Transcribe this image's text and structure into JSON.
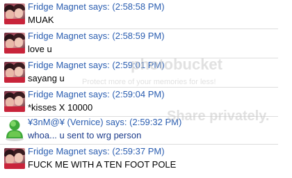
{
  "messages": [
    {
      "sender": "Fridge Magnet says:",
      "time": "(2:58:58 PM)",
      "text": "MUAK",
      "avatar": "photo-avatar"
    },
    {
      "sender": "Fridge Magnet says:",
      "time": "(2:58:59 PM)",
      "text": "love u",
      "avatar": "photo-avatar"
    },
    {
      "sender": "Fridge Magnet says:",
      "time": "(2:59:01 PM)",
      "text": "sayang u",
      "avatar": "photo-avatar"
    },
    {
      "sender": "Fridge Magnet says:",
      "time": "(2:59:04 PM)",
      "text": "*kisses X 10000",
      "avatar": "photo-avatar"
    },
    {
      "sender": "¥3nM@¥ (Vernice) says:",
      "time": "(2:59:32 PM)",
      "text": "whoa... u sent to wrg person",
      "avatar": "msn-buddy-avatar"
    },
    {
      "sender": "Fridge Magnet says:",
      "time": "(2:59:37 PM)",
      "text": "FUCK ME WITH A TEN FOOT POLE",
      "avatar": "photo-avatar"
    }
  ],
  "watermark": {
    "logo_text": "photobucket",
    "tagline": "Protect more of your memories for less!",
    "share_text": "Share privately."
  },
  "colors": {
    "sender": "#2a5db0",
    "body_text": "#000000",
    "vernice_body": "#1a3a8a",
    "divider": "#dcdcdc"
  }
}
